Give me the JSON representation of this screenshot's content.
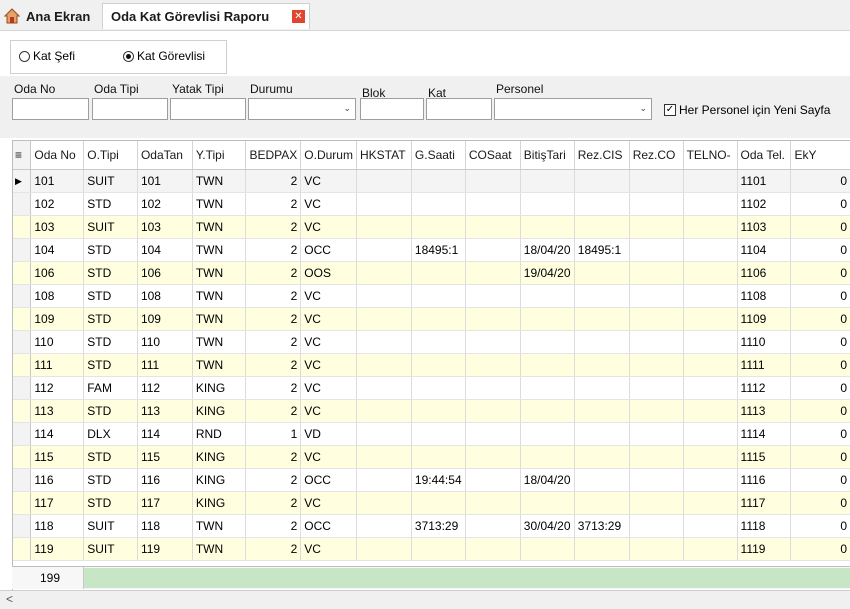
{
  "tabs": {
    "home_label": "Ana Ekran",
    "report_label": "Oda Kat Görevlisi Raporu",
    "close_glyph": "✕"
  },
  "mode": {
    "option1": "Kat Şefi",
    "option2": "Kat Görevlisi",
    "selected": "Kat Görevlisi"
  },
  "filters": {
    "oda_no": "Oda No",
    "oda_tipi": "Oda Tipi",
    "yatak_tipi": "Yatak Tipi",
    "durumu": "Durumu",
    "blok": "Blok",
    "kat": "Kat",
    "personel": "Personel",
    "new_page_checkbox": "Her Personel için Yeni Sayfa",
    "new_page_checked": true
  },
  "grid": {
    "columns": [
      "Oda No",
      "O.Tipi",
      "OdaTan",
      "Y.Tipi",
      "BEDPAX",
      "O.Durum",
      "HKSTAT",
      "G.Saati",
      "COSaat",
      "BitişTari",
      "Rez.CIS",
      "Rez.CO",
      "TELNO-",
      "Oda Tel.",
      "EkY"
    ],
    "rows": [
      [
        "101",
        "SUIT",
        "101",
        "TWN",
        "2",
        "VC",
        "",
        "",
        "",
        "",
        "",
        "",
        "",
        "1101",
        "0"
      ],
      [
        "102",
        "STD",
        "102",
        "TWN",
        "2",
        "VC",
        "",
        "",
        "",
        "",
        "",
        "",
        "",
        "1102",
        "0"
      ],
      [
        "103",
        "SUIT",
        "103",
        "TWN",
        "2",
        "VC",
        "",
        "",
        "",
        "",
        "",
        "",
        "",
        "1103",
        "0"
      ],
      [
        "104",
        "STD",
        "104",
        "TWN",
        "2",
        "OCC",
        "",
        "18495:1",
        "",
        "18/04/20",
        "18495:1",
        "",
        "",
        "1104",
        "0"
      ],
      [
        "106",
        "STD",
        "106",
        "TWN",
        "2",
        "OOS",
        "",
        "",
        "",
        "19/04/20",
        "",
        "",
        "",
        "1106",
        "0"
      ],
      [
        "108",
        "STD",
        "108",
        "TWN",
        "2",
        "VC",
        "",
        "",
        "",
        "",
        "",
        "",
        "",
        "1108",
        "0"
      ],
      [
        "109",
        "STD",
        "109",
        "TWN",
        "2",
        "VC",
        "",
        "",
        "",
        "",
        "",
        "",
        "",
        "1109",
        "0"
      ],
      [
        "110",
        "STD",
        "110",
        "TWN",
        "2",
        "VC",
        "",
        "",
        "",
        "",
        "",
        "",
        "",
        "1110",
        "0"
      ],
      [
        "111",
        "STD",
        "111",
        "TWN",
        "2",
        "VC",
        "",
        "",
        "",
        "",
        "",
        "",
        "",
        "1111",
        "0"
      ],
      [
        "112",
        "FAM",
        "112",
        "KING",
        "2",
        "VC",
        "",
        "",
        "",
        "",
        "",
        "",
        "",
        "1112",
        "0"
      ],
      [
        "113",
        "STD",
        "113",
        "KING",
        "2",
        "VC",
        "",
        "",
        "",
        "",
        "",
        "",
        "",
        "1113",
        "0"
      ],
      [
        "114",
        "DLX",
        "114",
        "RND",
        "1",
        "VD",
        "",
        "",
        "",
        "",
        "",
        "",
        "",
        "1114",
        "0"
      ],
      [
        "115",
        "STD",
        "115",
        "KING",
        "2",
        "VC",
        "",
        "",
        "",
        "",
        "",
        "",
        "",
        "1115",
        "0"
      ],
      [
        "116",
        "STD",
        "116",
        "KING",
        "2",
        "OCC",
        "",
        "19:44:54",
        "",
        "18/04/20",
        "",
        "",
        "",
        "1116",
        "0"
      ],
      [
        "117",
        "STD",
        "117",
        "KING",
        "2",
        "VC",
        "",
        "",
        "",
        "",
        "",
        "",
        "",
        "1117",
        "0"
      ],
      [
        "118",
        "SUIT",
        "118",
        "TWN",
        "2",
        "OCC",
        "",
        "3713:29",
        "",
        "30/04/20",
        "3713:29",
        "",
        "",
        "1118",
        "0"
      ],
      [
        "119",
        "SUIT",
        "119",
        "TWN",
        "2",
        "VC",
        "",
        "",
        "",
        "",
        "",
        "",
        "",
        "1119",
        "0"
      ]
    ],
    "selected_row": 0,
    "record_count": "199"
  },
  "scroll": {
    "left_arrow": "<"
  }
}
